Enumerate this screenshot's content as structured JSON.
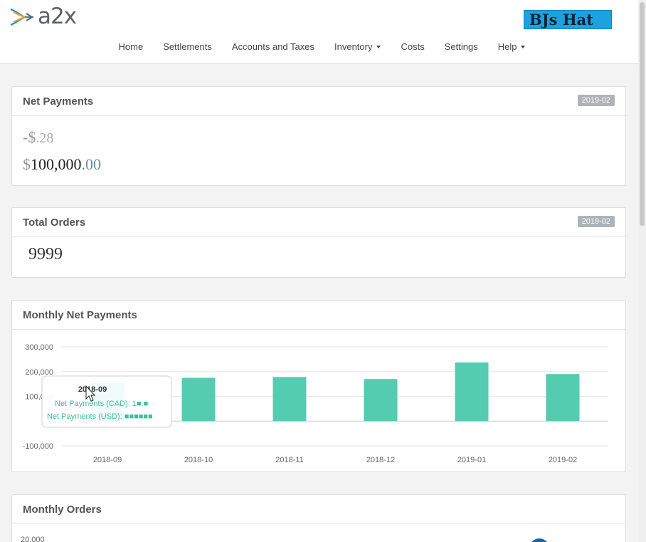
{
  "brand": {
    "name": "a2x"
  },
  "account": {
    "label": "BJs Hat"
  },
  "nav": [
    {
      "label": "Home",
      "has_caret": false
    },
    {
      "label": "Settlements",
      "has_caret": false
    },
    {
      "label": "Accounts and Taxes",
      "has_caret": false
    },
    {
      "label": "Inventory",
      "has_caret": true
    },
    {
      "label": "Costs",
      "has_caret": false
    },
    {
      "label": "Settings",
      "has_caret": false
    },
    {
      "label": "Help",
      "has_caret": true
    }
  ],
  "net_payments": {
    "title": "Net Payments",
    "period": "2019-02",
    "line1": {
      "currency": "-$",
      "main": "",
      "decimals": ".28"
    },
    "line2": {
      "currency": "$",
      "main": "100,000",
      "decimals": ".00"
    }
  },
  "total_orders": {
    "title": "Total Orders",
    "period": "2019-02",
    "value": "9999"
  },
  "monthly_net_payments": {
    "title": "Monthly Net Payments"
  },
  "monthly_orders": {
    "title": "Monthly Orders",
    "first_tick": "20,000"
  },
  "chart_data": {
    "type": "bar",
    "categories": [
      "2018-09",
      "2018-10",
      "2018-11",
      "2018-12",
      "2019-01",
      "2019-02"
    ],
    "series": [
      {
        "name": "Net Payments (CAD)",
        "values": [
          155000,
          175000,
          178000,
          170000,
          237000,
          190000
        ]
      }
    ],
    "y_ticks": [
      "300,000",
      "200,000",
      "100,000",
      "0",
      "-100,000"
    ],
    "ylim": [
      -100000,
      300000
    ],
    "grid": true,
    "bar_color": "#54ccb0",
    "tooltip": {
      "title": "2018-09",
      "rows": [
        {
          "label": "Net Payments (CAD):",
          "value": "1■.■"
        },
        {
          "label": "Net Payments (USD):",
          "value": "■■■■■■"
        }
      ]
    }
  },
  "colors": {
    "accent": "#1aa3e0",
    "bar": "#54ccb0",
    "badge_bg": "#aeb3b8"
  }
}
